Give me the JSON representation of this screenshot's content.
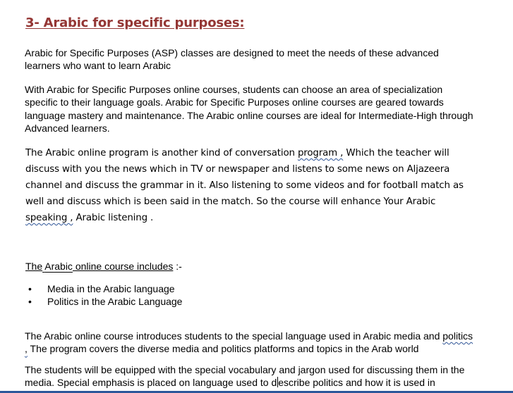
{
  "heading": "3- Arabic for specific purposes:",
  "para1": "Arabic for Specific Purposes (ASP) classes are designed to meet the needs of these advanced learners who want to learn Arabic",
  "para2": "With Arabic for Specific Purposes online courses, students can choose an area of specialization specific to their language goals. Arabic for Specific Purposes online courses are geared towards language mastery and maintenance. The Arabic online courses are ideal for Intermediate-High through Advanced learners.",
  "para3": {
    "part1": "The Arabic online program is another kind of conversation ",
    "flag1": "program ,",
    "part2": " Which the teacher will discuss with you the news which in TV or newspaper and listens to some news on Aljazeera channel and discuss the grammar in it. Also listening to some videos and for football match as well and discuss which is been said in the match. So the course will enhance Your Arabic ",
    "flag2": "speaking ,",
    "part3": " Arabic listening ."
  },
  "list": {
    "title_word1": "The",
    "title_sep": " ",
    "title_word2": "Arabic",
    "title_rest": " online course includes",
    "title_tail": " :-",
    "items": [
      "Media in the Arabic language",
      "Politics in the Arabic Language"
    ],
    "bullet_glyph": "•"
  },
  "para4": {
    "part1": "The Arabic online course introduces students to the special language used in Arabic media and ",
    "flag": "politics ,",
    "part2": " The program covers the diverse media and politics platforms and topics in the Arab world"
  },
  "para5": {
    "part1": "The students will be equipped with the special vocabulary and jargon used for discussing them in the media. Special emphasis is placed on language used to d",
    "part2": "escribe politics and how it is used in"
  },
  "colors": {
    "heading": "#943634",
    "spellcheck": "#2f5597",
    "statusbar": "#2b579a"
  }
}
